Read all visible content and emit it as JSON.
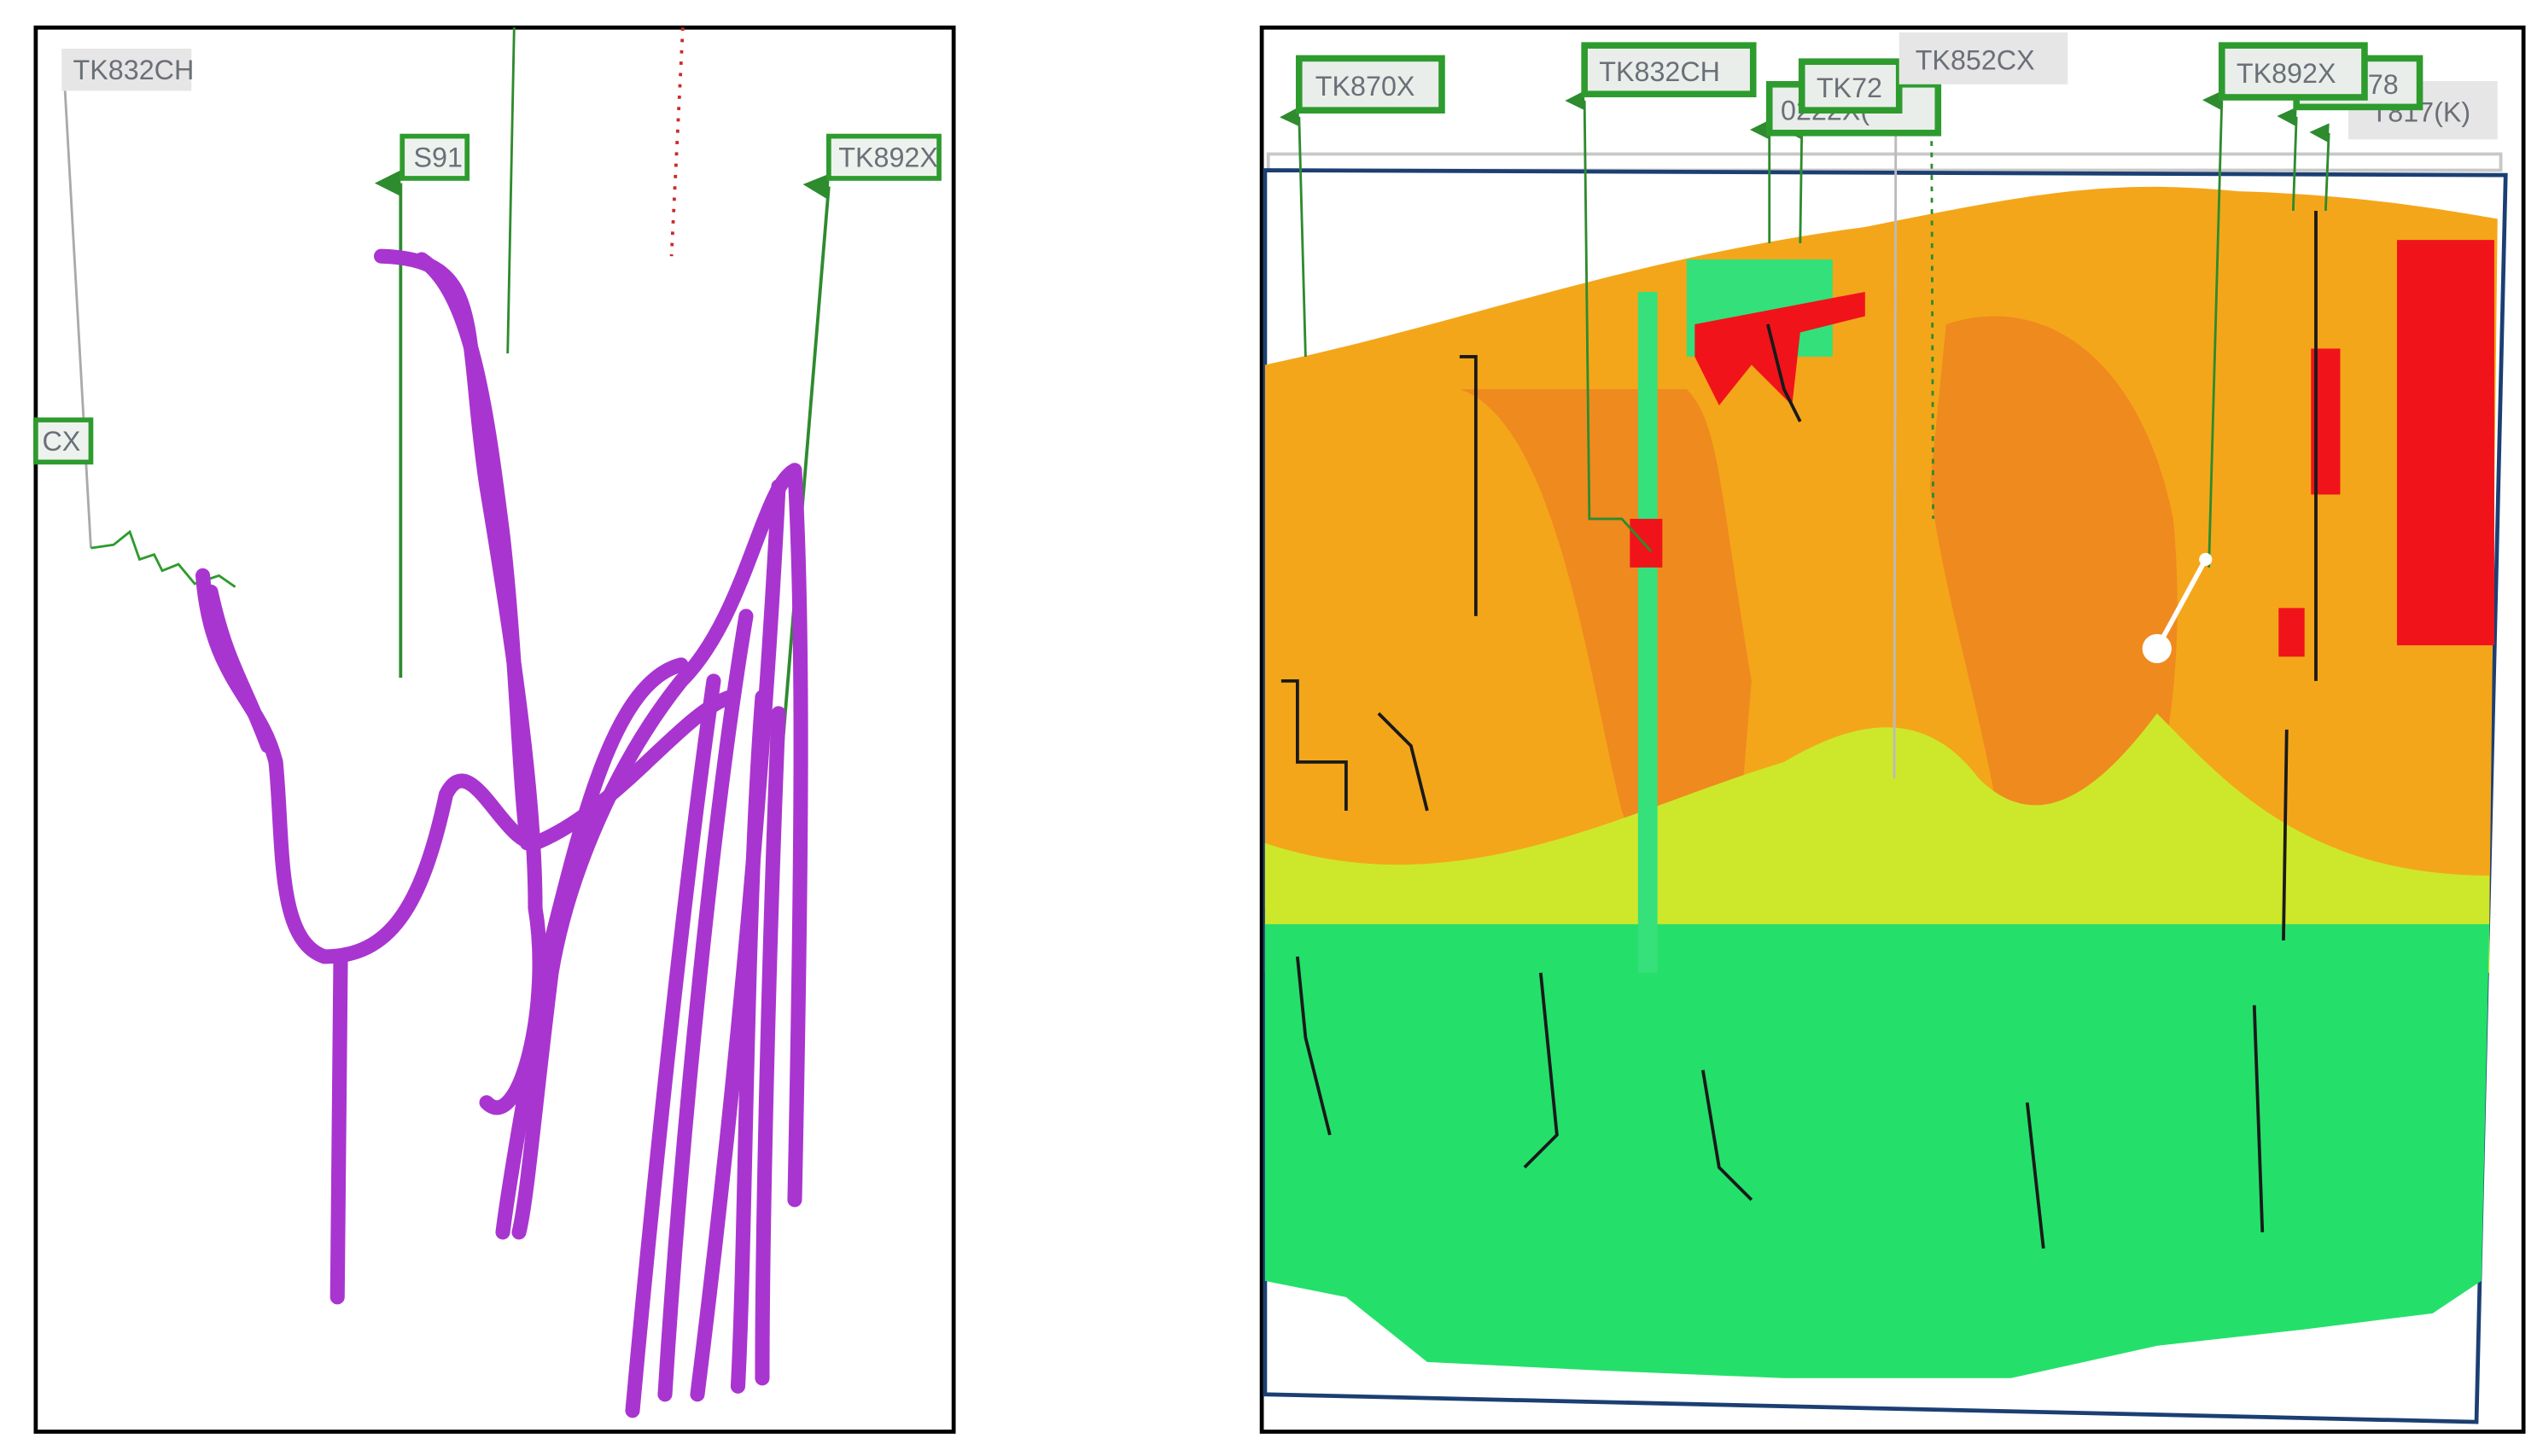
{
  "left_panel": {
    "labels": {
      "tk832ch": "TK832CH",
      "s91": "S91",
      "tk892x": "TK892X",
      "cx_partial": "CX"
    }
  },
  "right_panel": {
    "labels": {
      "tk870x": "TK870X",
      "tk832ch": "TK832CH",
      "tk72_partial": "TK72",
      "hidden_partial": "0222X(",
      "tk852cx": "TK852CX",
      "tk892x": "TK892X",
      "w78_partial": "78",
      "t817k_partial": "T817(K)"
    }
  },
  "colors": {
    "well_green": "#2e9b2e",
    "tube_purple": "#b13fd6",
    "high": "#f0131a",
    "mid": "#f4a21a",
    "low": "#22e06a"
  }
}
